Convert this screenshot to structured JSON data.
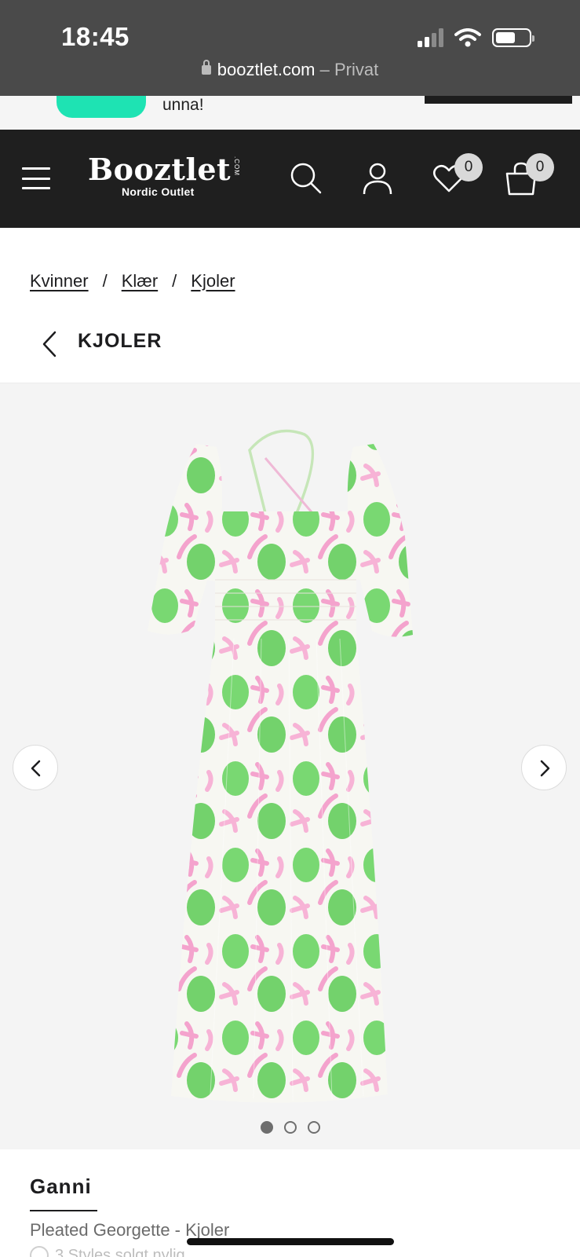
{
  "status_bar": {
    "time": "18:45",
    "url_domain": "booztlet.com",
    "url_suffix": " – Privat"
  },
  "promo": {
    "text": "unna!"
  },
  "header": {
    "logo_word": "Booztlet",
    "logo_tm": ".COM",
    "logo_sub": "Nordic Outlet",
    "wishlist_count": "0",
    "cart_count": "0"
  },
  "breadcrumb": {
    "items": [
      "Kvinner",
      "Klær",
      "Kjoler"
    ],
    "separator": "/"
  },
  "back_title": "KJOLER",
  "gallery": {
    "image_count": 3,
    "active_index": 0
  },
  "product": {
    "brand": "Ganni",
    "name": "Pleated Georgette - Kjoler",
    "sold_recent": "3 Styles solgt nylig"
  },
  "colors": {
    "header_bg": "#1f1f1f",
    "accent_green": "#1ee3b3",
    "gallery_bg": "#f4f4f4",
    "dress_pink": "#f4a8cf",
    "dress_green": "#5fd35a"
  }
}
